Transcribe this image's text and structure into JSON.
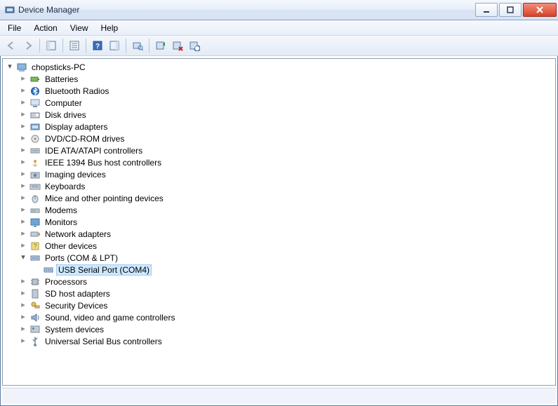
{
  "window": {
    "title": "Device Manager"
  },
  "menu": {
    "file": "File",
    "action": "Action",
    "view": "View",
    "help": "Help"
  },
  "tree": {
    "root": "chopsticks-PC",
    "items": [
      {
        "label": "Batteries"
      },
      {
        "label": "Bluetooth Radios"
      },
      {
        "label": "Computer"
      },
      {
        "label": "Disk drives"
      },
      {
        "label": "Display adapters"
      },
      {
        "label": "DVD/CD-ROM drives"
      },
      {
        "label": "IDE ATA/ATAPI controllers"
      },
      {
        "label": "IEEE 1394 Bus host controllers"
      },
      {
        "label": "Imaging devices"
      },
      {
        "label": "Keyboards"
      },
      {
        "label": "Mice and other pointing devices"
      },
      {
        "label": "Modems"
      },
      {
        "label": "Monitors"
      },
      {
        "label": "Network adapters"
      },
      {
        "label": "Other devices"
      },
      {
        "label": "Ports (COM & LPT)"
      },
      {
        "label": "Processors"
      },
      {
        "label": "SD host adapters"
      },
      {
        "label": "Security Devices"
      },
      {
        "label": "Sound, video and game controllers"
      },
      {
        "label": "System devices"
      },
      {
        "label": "Universal Serial Bus controllers"
      }
    ],
    "ports_child": "USB Serial Port (COM4)"
  }
}
